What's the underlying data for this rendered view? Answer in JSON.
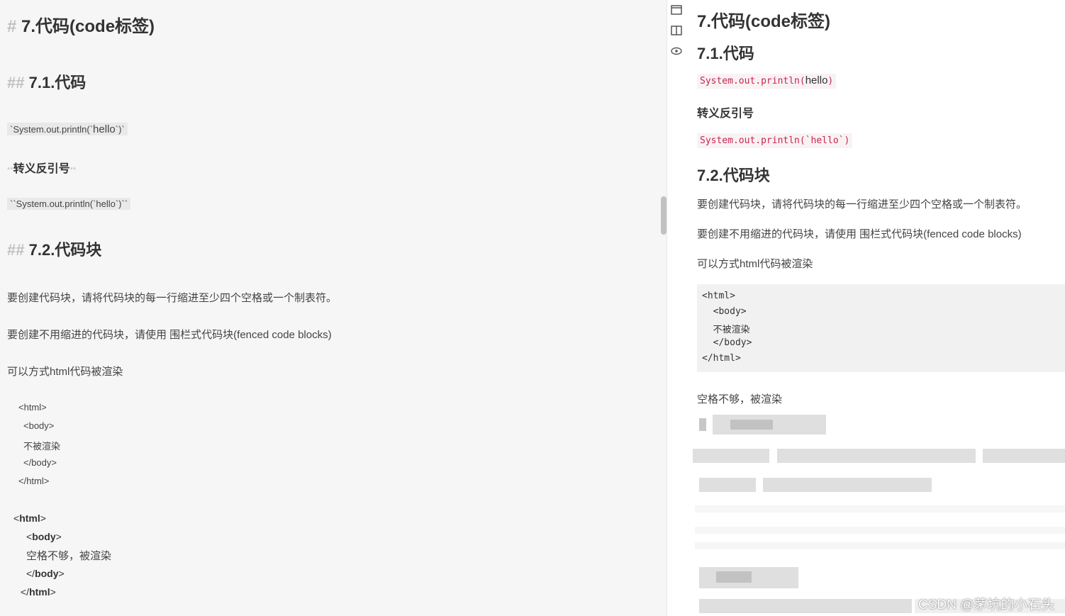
{
  "editor": {
    "h1": {
      "mark": "#",
      "text": "7.代码(code标签)"
    },
    "h2_code": {
      "mark": "##",
      "text": "7.1.代码"
    },
    "inline1": {
      "pre": "`System.out.println(`",
      "word": "hello",
      "post": "`)`"
    },
    "bold_escape": {
      "mark_open": "**",
      "text": "转义反引号",
      "mark_close": "**"
    },
    "inline2": "``System.out.println(`hello`)``",
    "h2_block": {
      "mark": "##",
      "text": "7.2.代码块"
    },
    "para1": "要创建代码块，请将代码块的每一行缩进至少四个空格或一个制表符。",
    "para2": "要创建不用缩进的代码块，请使用 围栏式代码块(fenced code blocks)",
    "para3": "可以方式html代码被渲染",
    "code_lines": [
      "<html>",
      "<body>",
      "不被渲染",
      "</body>",
      "</html>"
    ],
    "render_lines": [
      {
        "open": "<",
        "tag": "html",
        "close": ">"
      },
      {
        "open": "<",
        "tag": "body",
        "close": ">"
      },
      {
        "text": "空格不够，被渲染"
      },
      {
        "open": "</",
        "tag": "body",
        "close": ">"
      },
      {
        "open": "</",
        "tag": "html",
        "close": ">"
      }
    ]
  },
  "toolbar": {
    "icons": [
      "single-pane-icon",
      "split-view-icon",
      "preview-eye-icon"
    ]
  },
  "preview": {
    "h1": "7.代码(code标签)",
    "h2_code": "7.1.代码",
    "inline1": {
      "pre": "System.out.println(",
      "word": "hello",
      "post": ")"
    },
    "bold_escape": "转义反引号",
    "inline2": "System.out.println(`hello`)",
    "h2_block": "7.2.代码块",
    "para1": "要创建代码块，请将代码块的每一行缩进至少四个空格或一个制表符。",
    "para2": "要创建不用缩进的代码块，请使用 围栏式代码块(fenced code blocks)",
    "para3": "可以方式html代码被渲染",
    "code_lines": [
      "<html>",
      "  <body>",
      "  不被渲染",
      "  </body>",
      "</html>"
    ],
    "para4": "空格不够，被渲染"
  },
  "watermark": "CSDN @茅坑的小石头",
  "colors": {
    "editor_bg": "#f6f6f6",
    "markdown_mark": "#c0c0c0",
    "inline_code_fg": "#c7254e",
    "inline_code_bg": "#f9f2f4",
    "code_block_bg": "#f1f1f1"
  }
}
